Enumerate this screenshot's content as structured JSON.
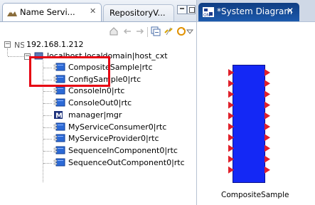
{
  "left_panel": {
    "tab_active_label": "Name Servi...",
    "tab_close_glyph": "✕",
    "tab_inactive_label": "RepositoryV...",
    "toolbar_icons": [
      "home-icon",
      "back-icon",
      "forward-icon",
      "collapse-all-icon",
      "link-icon",
      "refresh-icon",
      "connect-icon",
      "view-menu-icon"
    ]
  },
  "tree": {
    "root_label": "192.168.1.212",
    "host_label": "localhost.localdomain|host_cxt",
    "items": [
      {
        "label": "CompositeSample|rtc",
        "icon": "rtc-component-icon"
      },
      {
        "label": "ConfigSample0|rtc",
        "icon": "rtc-component-icon"
      },
      {
        "label": "ConsoleIn0|rtc",
        "icon": "rtc-component-icon"
      },
      {
        "label": "ConsoleOut0|rtc",
        "icon": "rtc-component-icon"
      },
      {
        "label": "manager|mgr",
        "icon": "manager-icon"
      },
      {
        "label": "MyServiceConsumer0|rtc",
        "icon": "rtc-component-icon"
      },
      {
        "label": "MyServiceProvider0|rtc",
        "icon": "rtc-component-icon"
      },
      {
        "label": "SequenceInComponent0|rtc",
        "icon": "rtc-component-icon"
      },
      {
        "label": "SequenceOutComponent0|rtc",
        "icon": "rtc-component-icon"
      }
    ]
  },
  "editor": {
    "tab_label": "*System Diagram",
    "tab_close": "✕",
    "component_label": "CompositeSample",
    "component_color": "#1428f5",
    "port_color": "#e0202a",
    "highlight_color": "#e60012"
  }
}
